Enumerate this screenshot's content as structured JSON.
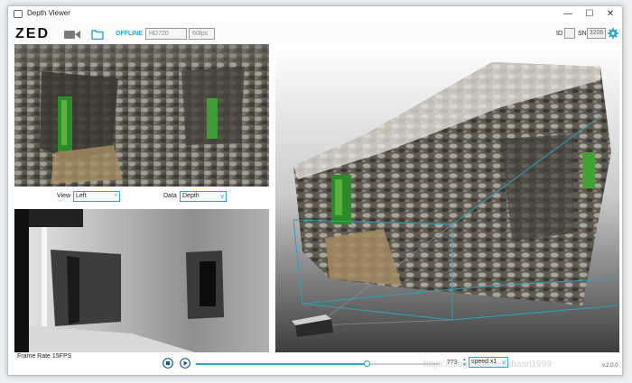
{
  "window": {
    "title": "Depth Viewer",
    "minimize": "—",
    "maximize": "☐",
    "close": "✕"
  },
  "toolbar": {
    "logo": "ZED",
    "status": "OFFLINE",
    "resolution": "HD720",
    "fps": "60fps",
    "id_label": "ID",
    "sn_label": "SN",
    "sn_value": "3206"
  },
  "left_view": {
    "label": "View",
    "value": "Left"
  },
  "data_view": {
    "label": "Data",
    "value": "Depth"
  },
  "status_bar": {
    "frame_rate": "Frame Rate 15FPS"
  },
  "playback": {
    "frame": "773",
    "speed": "speed x1",
    "position": 0.7
  },
  "version": "v.2.0.0",
  "watermark": "https://blog.csdn.net/xbaan1999",
  "colors": {
    "accent": "#2aa6c9",
    "depth_bg": "#111111"
  }
}
